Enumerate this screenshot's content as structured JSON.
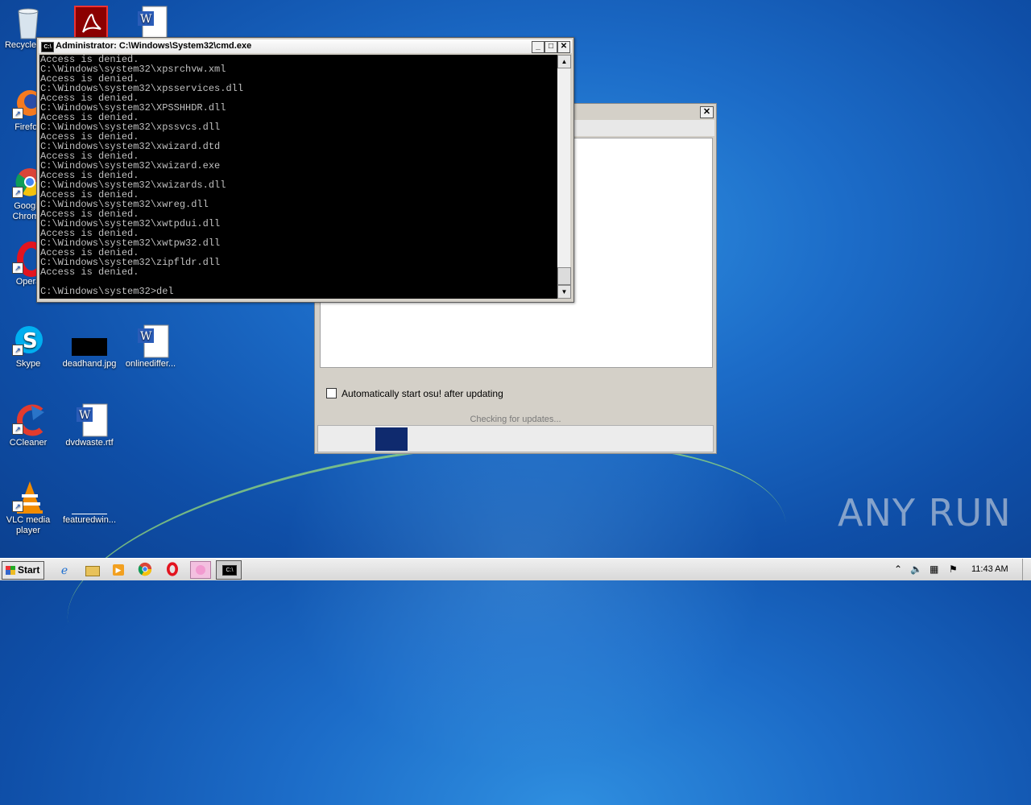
{
  "desktop": {
    "icons": [
      {
        "id": "recycle",
        "label": "Recycle Bin",
        "icon": "recycle-bin-icon"
      },
      {
        "id": "acrobat",
        "label": "",
        "icon": "acrobat-icon"
      },
      {
        "id": "word1",
        "label": "",
        "icon": "word-doc-icon"
      },
      {
        "id": "firefox",
        "label": "Firefox",
        "icon": "firefox-icon"
      },
      {
        "id": "chrome",
        "label": "Google Chrome",
        "icon": "chrome-icon"
      },
      {
        "id": "opera",
        "label": "Opera",
        "icon": "opera-icon"
      },
      {
        "id": "skype",
        "label": "Skype",
        "icon": "skype-icon"
      },
      {
        "id": "deadhand",
        "label": "deadhand.jpg",
        "icon": "image-file-icon"
      },
      {
        "id": "onlinediffer",
        "label": "onlinediffer...",
        "icon": "word-doc-icon"
      },
      {
        "id": "ccleaner",
        "label": "CCleaner",
        "icon": "ccleaner-icon"
      },
      {
        "id": "dvdwaste",
        "label": "dvdwaste.rtf",
        "icon": "word-doc-icon"
      },
      {
        "id": "vlc",
        "label": "VLC media player",
        "icon": "vlc-icon"
      },
      {
        "id": "featuredwin",
        "label": "featuredwin...",
        "icon": "image-file-icon"
      }
    ]
  },
  "cmd": {
    "title": "Administrator: C:\\Windows\\System32\\cmd.exe",
    "minimize": "_",
    "maximize": "□",
    "close": "✕",
    "lines": [
      "Access is denied.",
      "C:\\Windows\\system32\\xpsrchvw.xml",
      "Access is denied.",
      "C:\\Windows\\system32\\xpsservices.dll",
      "Access is denied.",
      "C:\\Windows\\system32\\XPSSHHDR.dll",
      "Access is denied.",
      "C:\\Windows\\system32\\xpssvcs.dll",
      "Access is denied.",
      "C:\\Windows\\system32\\xwizard.dtd",
      "Access is denied.",
      "C:\\Windows\\system32\\xwizard.exe",
      "Access is denied.",
      "C:\\Windows\\system32\\xwizards.dll",
      "Access is denied.",
      "C:\\Windows\\system32\\xwreg.dll",
      "Access is denied.",
      "C:\\Windows\\system32\\xwtpdui.dll",
      "Access is denied.",
      "C:\\Windows\\system32\\xwtpw32.dll",
      "Access is denied.",
      "C:\\Windows\\system32\\zipfldr.dll",
      "Access is denied.",
      "",
      "C:\\Windows\\system32>del"
    ]
  },
  "updater": {
    "close": "✕",
    "checkbox_label": "Automatically start osu! after updating",
    "checkbox_checked": false,
    "status": "Checking for updates..."
  },
  "watermark": "ANY RUN",
  "taskbar": {
    "start_label": "Start",
    "clock": "11:43 AM",
    "pinned": [
      "ie-icon",
      "explorer-icon",
      "media-player-icon",
      "chrome-icon",
      "opera-icon",
      "osu-icon",
      "cmd-icon"
    ]
  }
}
